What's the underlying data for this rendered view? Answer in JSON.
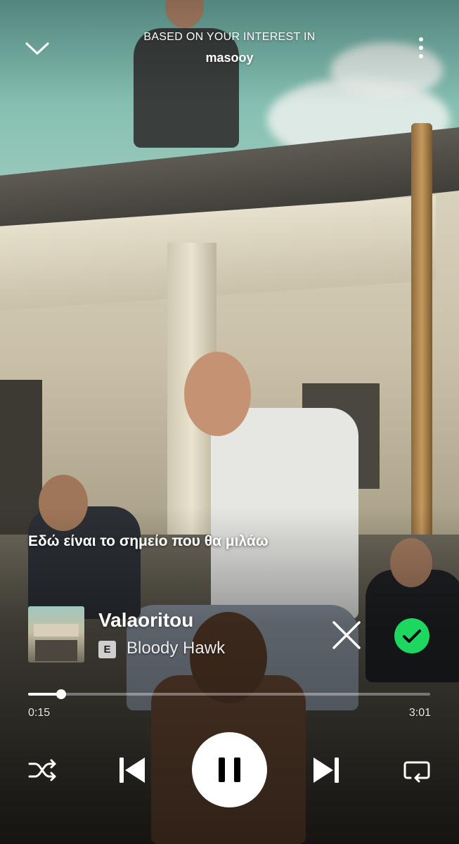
{
  "header": {
    "context_label": "BASED ON YOUR INTEREST IN",
    "context_title": "masooy",
    "collapse_icon": "chevron-down-icon",
    "more_icon": "more-vertical-icon"
  },
  "lyric": {
    "current_line": "Εδώ είναι το σημείο που θα μιλάω"
  },
  "track": {
    "title": "Valaoritou",
    "explicit_badge": "E",
    "artist": "Bloody Hawk",
    "dislike_icon": "close-icon",
    "saved_icon": "check-circle-icon"
  },
  "playback": {
    "elapsed": "0:15",
    "total": "3:01",
    "progress_fraction": 0.083,
    "is_playing": true
  },
  "controls": {
    "shuffle_icon": "shuffle-icon",
    "previous_icon": "skip-previous-icon",
    "pause_icon": "pause-icon",
    "next_icon": "skip-next-icon",
    "repeat_icon": "repeat-icon"
  },
  "colors": {
    "accent_green": "#1ed760",
    "text_primary": "#ffffff"
  }
}
